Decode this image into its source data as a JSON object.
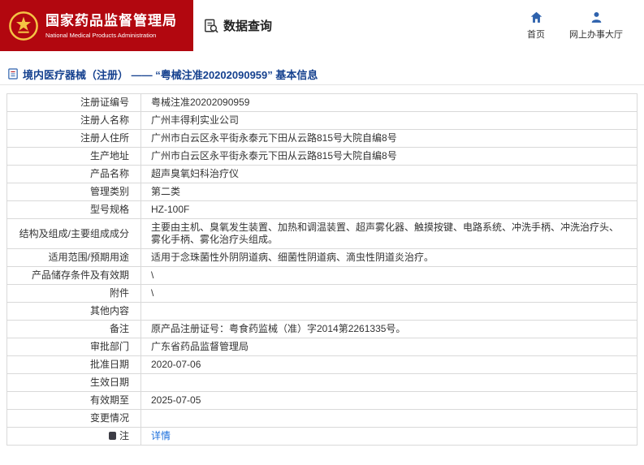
{
  "header": {
    "agency_name": "国家药品监督管理局",
    "agency_name_en": "National Medical Products Administration",
    "data_query_label": "数据查询",
    "nav": [
      {
        "label": "首页",
        "icon": "home-icon"
      },
      {
        "label": "网上办事大厅",
        "icon": "person-icon"
      }
    ]
  },
  "title_bar": {
    "title": "境内医疗器械（注册） —— “粤械注准20202090959” 基本信息",
    "icon": "document-icon"
  },
  "table": {
    "rows": [
      {
        "label": "注册证编号",
        "value": "粤械注准20202090959"
      },
      {
        "label": "注册人名称",
        "value": "广州丰得利实业公司"
      },
      {
        "label": "注册人住所",
        "value": "广州市白云区永平街永泰元下田从云路815号大院自编8号"
      },
      {
        "label": "生产地址",
        "value": "广州市白云区永平街永泰元下田从云路815号大院自编8号"
      },
      {
        "label": "产品名称",
        "value": "超声臭氧妇科治疗仪"
      },
      {
        "label": "管理类别",
        "value": "第二类"
      },
      {
        "label": "型号规格",
        "value": "HZ-100F"
      },
      {
        "label": "结构及组成/主要组成成分",
        "value": "主要由主机、臭氧发生装置、加热和调温装置、超声雾化器、触摸按键、电路系统、冲洗手柄、冲洗治疗头、雾化手柄、雾化治疗头组成。"
      },
      {
        "label": "适用范围/预期用途",
        "value": "适用于念珠菌性外阴阴道病、细菌性阴道病、滴虫性阴道炎治疗。"
      },
      {
        "label": "产品储存条件及有效期",
        "value": "\\"
      },
      {
        "label": "附件",
        "value": "\\"
      },
      {
        "label": "其他内容",
        "value": ""
      },
      {
        "label": "备注",
        "value": "原产品注册证号：粤食药监械（准）字2014第2261335号。"
      },
      {
        "label": "审批部门",
        "value": "广东省药品监督管理局"
      },
      {
        "label": "批准日期",
        "value": "2020-07-06"
      },
      {
        "label": "生效日期",
        "value": ""
      },
      {
        "label": "有效期至",
        "value": "2025-07-05"
      },
      {
        "label": "变更情况",
        "value": ""
      },
      {
        "label": "注",
        "icon": "note-icon",
        "value": "详情",
        "link": true
      }
    ]
  },
  "icons": {
    "emblem": "national-emblem",
    "data_query": "document-search-icon",
    "nav_home": "home-icon",
    "nav_service_hall": "person-icon",
    "title": "document-icon",
    "note_row": "note-icon"
  },
  "colors": {
    "header_red": "#b2070f",
    "emblem_gold": "#f5c344",
    "title_blue": "#15418f",
    "link_blue": "#1a6edc",
    "nav_icon_blue": "#2e62ad",
    "border_gray": "#d9d9d9"
  }
}
